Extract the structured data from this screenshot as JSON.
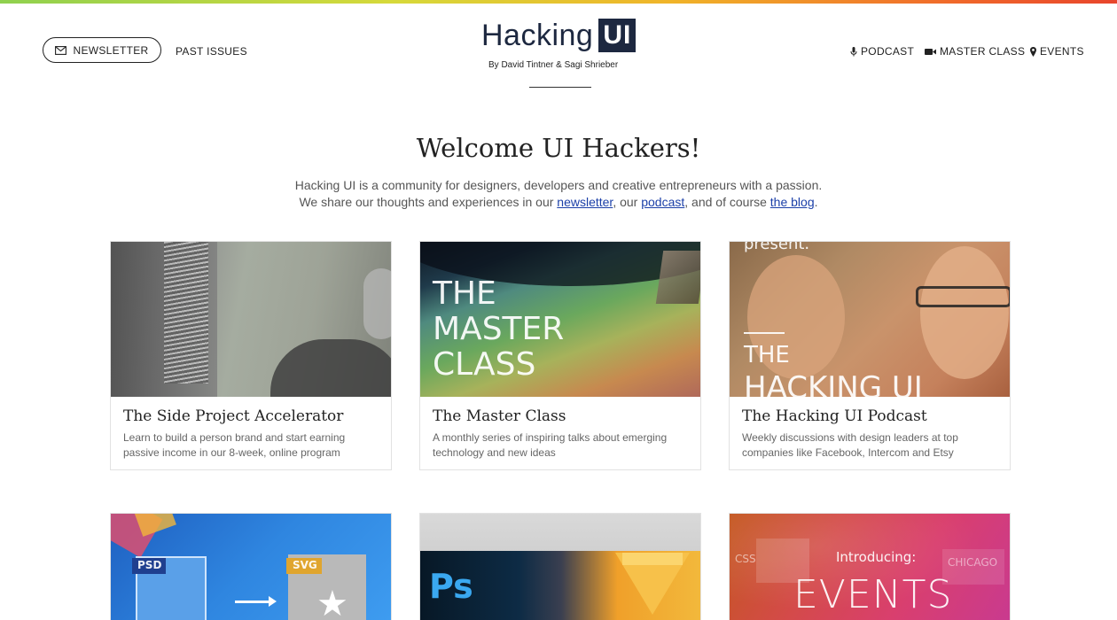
{
  "header": {
    "newsletter_label": "NEWSLETTER",
    "past_issues_label": "PAST ISSUES",
    "logo_text": "Hacking",
    "logo_badge": "UI",
    "byline": "By David Tintner & Sagi Shrieber",
    "nav": [
      {
        "label": "PODCAST",
        "icon": "microphone-icon"
      },
      {
        "label": "MASTER CLASS",
        "icon": "video-camera-icon"
      },
      {
        "label": "EVENTS",
        "icon": "map-pin-icon"
      }
    ]
  },
  "hero": {
    "title": "Welcome UI Hackers!",
    "line1": "Hacking UI is a community for designers, developers and creative entrepreneurs with a passion.",
    "line2_prefix": "We share our thoughts and experiences in our ",
    "link_newsletter": "newsletter",
    "sep1": ", our ",
    "link_podcast": "podcast",
    "sep2": ", and of course ",
    "link_blog": "the blog",
    "line2_suffix": "."
  },
  "cards": [
    {
      "title": "The Side Project Accelerator",
      "desc": "Learn to build a person brand and start earning passive income in our 8-week, online program"
    },
    {
      "title": "The Master Class",
      "desc": "A monthly series of inspiring talks about emerging technology and new ideas",
      "image_text": [
        "THE",
        "MASTER",
        "CLASS"
      ]
    },
    {
      "title": "The Hacking UI Podcast",
      "desc": "Weekly discussions with design leaders at top companies like Facebook, Intercom and Etsy",
      "image_text": [
        "present.",
        "THE",
        "HACKING UI"
      ]
    },
    {
      "image_text": [
        "PSD",
        "SVG"
      ]
    },
    {
      "image_text": [
        "Ps"
      ]
    },
    {
      "image_text": [
        "Introducing:",
        "EVENTS",
        "CSS",
        "CHICAGO"
      ]
    }
  ],
  "colors": {
    "logo_navy": "#1d2840",
    "link_blue": "#1b3fa8"
  }
}
